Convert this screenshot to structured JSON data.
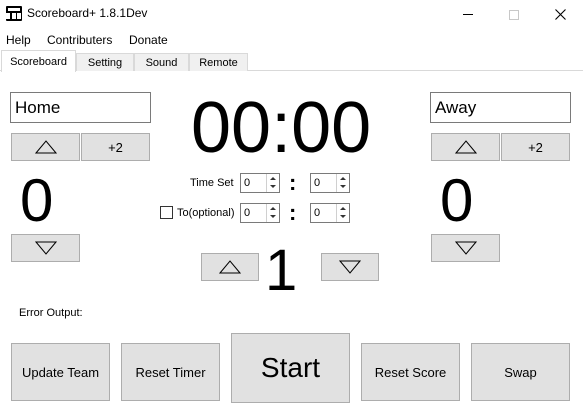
{
  "window": {
    "title": "Scoreboard+ 1.8.1Dev"
  },
  "menu": [
    "Help",
    "Contributers",
    "Donate"
  ],
  "tabs": [
    "Scoreboard",
    "Setting",
    "Sound",
    "Remote"
  ],
  "active_tab": "Scoreboard",
  "home": {
    "name": "Home",
    "score": "0",
    "plus_two_label": "+2"
  },
  "away": {
    "name": "Away",
    "score": "0",
    "plus_two_label": "+2"
  },
  "clock": "00:00",
  "time_set": {
    "label": "Time Set",
    "minutes": "0",
    "seconds": "0",
    "separator": ":"
  },
  "to_optional": {
    "label": "To(optional)",
    "checked": false,
    "minutes": "0",
    "seconds": "0",
    "separator": ":"
  },
  "period": "1",
  "error_output_label": "Error Output:",
  "buttons": {
    "update_team": "Update Team",
    "reset_timer": "Reset Timer",
    "start": "Start",
    "reset_score": "Reset Score",
    "swap": "Swap"
  },
  "icons": {
    "up": "triangle-up-outline",
    "down": "triangle-down-outline",
    "app": "scoreboard-icon"
  }
}
